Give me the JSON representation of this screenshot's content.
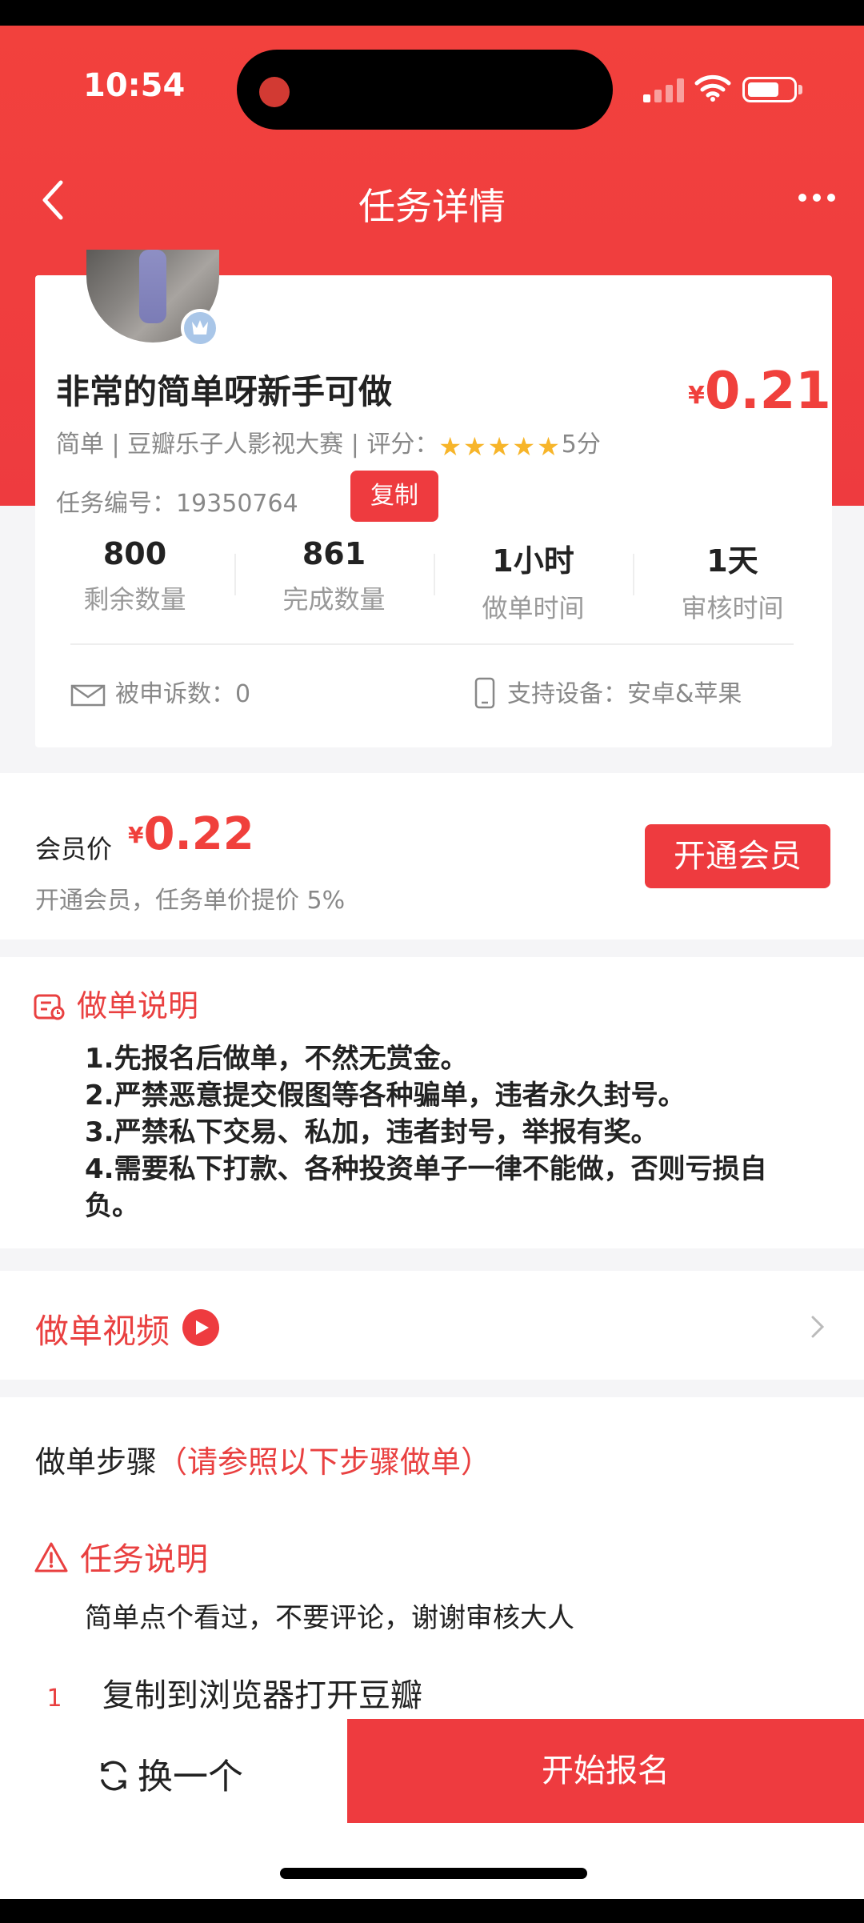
{
  "status_bar": {
    "time": "10:54"
  },
  "nav": {
    "title": "任务详情"
  },
  "task": {
    "title": "非常的简单呀新手可做",
    "price_symbol": "¥",
    "price": "0.21",
    "meta": "简单 | 豆瓣乐子人影视大赛 | 评分：",
    "rating_text": "5分",
    "rating": 5,
    "id_label": "任务编号：",
    "id_value": "19350764",
    "copy_label": "复制",
    "stats": [
      {
        "value": "800",
        "label": "剩余数量"
      },
      {
        "value": "861",
        "label": "完成数量"
      },
      {
        "value": "1小时",
        "label": "做单时间"
      },
      {
        "value": "1天",
        "label": "审核时间"
      }
    ],
    "complaints": "被申诉数：0",
    "devices": "支持设备：安卓&苹果"
  },
  "member": {
    "label": "会员价",
    "price_symbol": "¥",
    "price": "0.22",
    "sub": "开通会员，任务单价提价 5%",
    "button": "开通会员"
  },
  "instructions": {
    "title": "做单说明",
    "items": [
      "1.先报名后做单，不然无赏金。",
      "2.严禁恶意提交假图等各种骗单，违者永久封号。",
      "3.严禁私下交易、私加，违者封号，举报有奖。",
      "4.需要私下打款、各种投资单子一律不能做，否则亏损自负。"
    ]
  },
  "video": {
    "label": "做单视频"
  },
  "steps": {
    "title": "做单步骤",
    "hint": "（请参照以下步骤做单）",
    "desc_title": "任务说明",
    "desc": "简单点个看过，不要评论，谢谢审核大人",
    "items": [
      {
        "num": "1",
        "text": "复制到浏览器打开豆瓣"
      }
    ]
  },
  "bottom": {
    "swap_label": "换一个",
    "start_label": "开始报名"
  },
  "colors": {
    "accent": "#ee3b3f",
    "star": "#f7b52a"
  }
}
